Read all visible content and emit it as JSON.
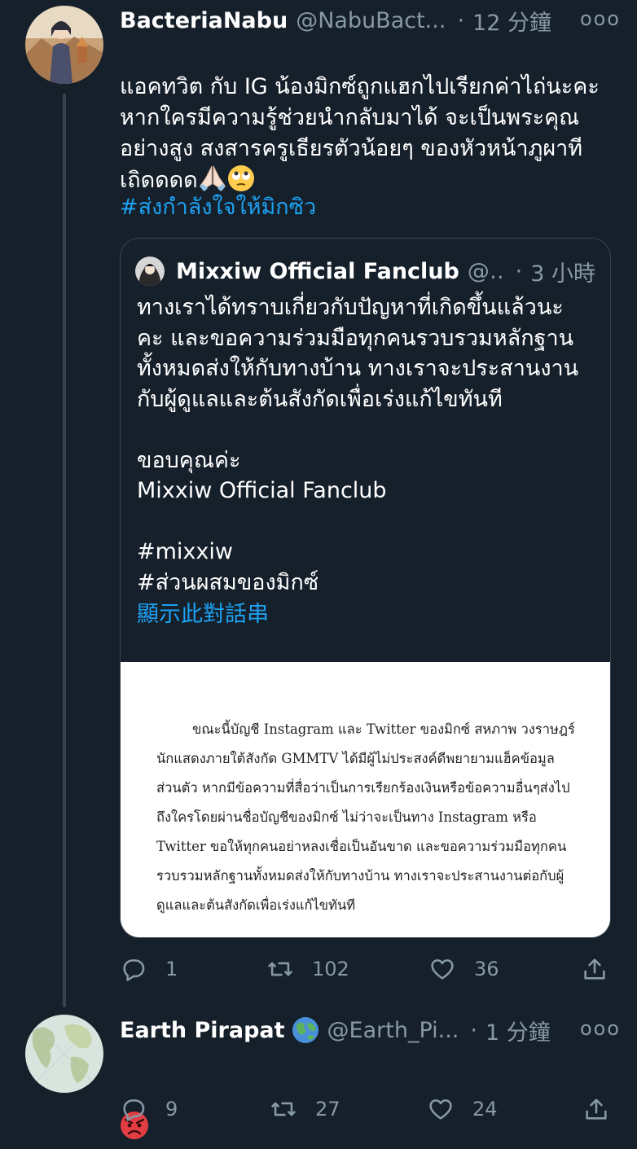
{
  "tweets": [
    {
      "name": "BacteriaNabu",
      "handle": "@NabuBact...",
      "time": "12 分鐘",
      "more": "ooo",
      "body": "แอคทวิต กับ IG น้องมิกซ์ถูกแฮกไปเรียกค่าไถ่นะคะ\nหากใครมีความรู้ช่วยนำกลับมาได้ จะเป็นพระคุณ\nอย่างสูง  สงสารครูเธียรตัวน้อยๆ ของหัวหน้าภูผาที\nเถิดดดด",
      "emojis": [
        "folded-hands-emoji",
        "face-with-rolling-eyes-emoji"
      ],
      "hashtag": "#ส่งกำลังใจให้มิกซิว",
      "quote": {
        "name": "Mixxiw Official Fanclub",
        "handle": "@...",
        "time": "3 小時",
        "body_lines": [
          "ทางเราได้ทราบเกี่ยวกับปัญหาที่เกิดขึ้นแล้วนะ",
          "คะ และขอความร่วมมือทุกคนรวบรวมหลักฐาน",
          "ทั้งหมดส่งให้กับทางบ้าน ทางเราจะประสานงาน",
          "กับผู้ดูแลและต้นสังกัดเพื่อเร่งแก้ไขทันที"
        ],
        "thanks": "ขอบคุณค่ะ",
        "signature": "Mixxiw Official Fanclub",
        "hashtag1": "#mixxiw",
        "hashtag2": "#ส่วนผสมของมิกซ์",
        "show_thread": "顯示此對話串",
        "image_text": "ขณะนี้บัญชี Instagram และ Twitter ของมิกซ์ สหภาพ วงราษฎร์ นักแสดงภายใต้สังกัด GMMTV ได้มีผู้ไม่ประสงค์ดีพยายามแฮ็คข้อมูลส่วนตัว หากมีข้อความที่สื่อว่าเป็นการเรียกร้องเงินหรือข้อความอื่นๆส่งไปถึงใครโดยผ่านชื่อบัญชีของมิกซ์ ไม่ว่าจะเป็นทาง Instagram หรือ Twitter ขอให้ทุกคนอย่าหลงเชื่อเป็นอันขาด และขอความร่วมมือทุกคนรวบรวมหลักฐานทั้งหมดส่งให้กับทางบ้าน ทางเราจะประสานงานต่อกับผู้ดูแลและต้นสังกัดเพื่อเร่งแก้ไขทันที"
      },
      "replies": "1",
      "retweets": "102",
      "likes": "36"
    },
    {
      "name": "Earth Pirapat",
      "name_emoji": "globe-emoji",
      "handle": "@Earth_Pi...",
      "time": "1 分鐘",
      "more": "ooo",
      "body_emoji": "angry-face-emoji",
      "replies": "9",
      "retweets": "27",
      "likes": "24"
    }
  ],
  "colors": {
    "background": "#15202b",
    "text": "#ffffff",
    "secondary": "#8899a6",
    "link": "#1da1f2",
    "border": "#38444d"
  }
}
